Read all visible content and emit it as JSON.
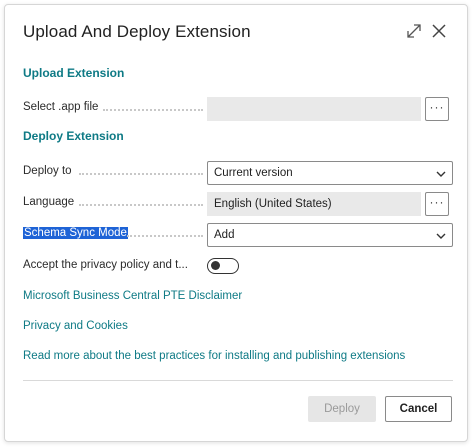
{
  "dialog": {
    "title": "Upload And Deploy Extension",
    "expand_icon": "expand-icon",
    "close_icon": "close-icon"
  },
  "upload_section": {
    "heading": "Upload Extension",
    "select_file_label": "Select .app file",
    "select_file_value": "",
    "browse_button_label": "···"
  },
  "deploy_section": {
    "heading": "Deploy Extension",
    "deploy_to_label": "Deploy to",
    "deploy_to_value": "Current version",
    "language_label": "Language",
    "language_value": "English (United States)",
    "language_button_label": "···",
    "schema_sync_label": "Schema Sync Mode",
    "schema_sync_value": "Add",
    "privacy_label": "Accept the privacy policy and t...",
    "privacy_toggle_on": false
  },
  "links": {
    "disclaimer": "Microsoft Business Central PTE Disclaimer",
    "privacy": "Privacy and Cookies",
    "best_practices": "Read more about the best practices for installing and publishing extensions"
  },
  "footer": {
    "deploy_label": "Deploy",
    "cancel_label": "Cancel"
  },
  "colors": {
    "accent": "#0e7a85",
    "selection": "#1e63d6",
    "disabled_button": "#e6e6e6"
  }
}
